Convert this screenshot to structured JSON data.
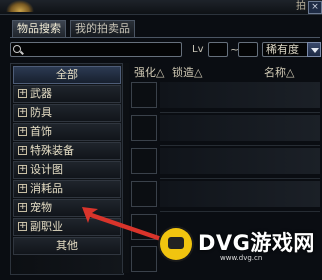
{
  "window": {
    "title": "拍",
    "close_label": "×"
  },
  "tabs": [
    {
      "label": "物品搜索",
      "active": true
    },
    {
      "label": "我的拍卖品",
      "active": false
    }
  ],
  "search": {
    "value": "",
    "lv_label": "Lv",
    "lv_separator": "~",
    "rarity_selected": "稀有度"
  },
  "categories": [
    {
      "label": "全部",
      "expandable": false,
      "active": true
    },
    {
      "label": "武器",
      "expandable": true
    },
    {
      "label": "防具",
      "expandable": true
    },
    {
      "label": "首饰",
      "expandable": true
    },
    {
      "label": "特殊装备",
      "expandable": true
    },
    {
      "label": "设计图",
      "expandable": true
    },
    {
      "label": "消耗品",
      "expandable": true
    },
    {
      "label": "宠物",
      "expandable": true
    },
    {
      "label": "副职业",
      "expandable": true
    },
    {
      "label": "其他",
      "expandable": false
    }
  ],
  "columns": {
    "enhance": "强化△",
    "lock": "锁造△",
    "name": "名称△"
  },
  "watermark": {
    "brand": "DVG游戏网",
    "url": "www.dvg.cn"
  },
  "colors": {
    "annotation_arrow": "#d9342b",
    "active_tab": "#3c4450",
    "watermark_logo": "#f1c40f"
  }
}
